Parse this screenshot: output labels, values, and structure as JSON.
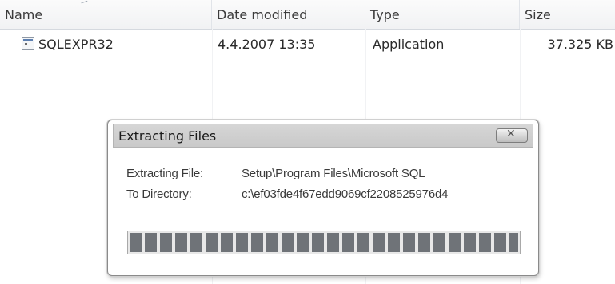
{
  "columns": {
    "name": "Name",
    "date_modified": "Date modified",
    "type": "Type",
    "size": "Size"
  },
  "files": [
    {
      "icon": "application-icon",
      "name": "SQLEXPR32",
      "date_modified": "4.4.2007 13:35",
      "type": "Application",
      "size": "37.325 KB"
    }
  ],
  "dialog": {
    "title": "Extracting Files",
    "close_icon": "close-icon",
    "extracting_label": "Extracting File:",
    "extracting_value": "Setup\\Program Files\\Microsoft SQL",
    "directory_label": "To Directory:",
    "directory_value": "c:\\ef03fde4f67edd9069cf2208525976d4",
    "progress": 1.0
  },
  "colors": {
    "header_bg": "#f1f2f4",
    "title_bar": "#cfcfcf",
    "progress_block": "#6f7378"
  }
}
